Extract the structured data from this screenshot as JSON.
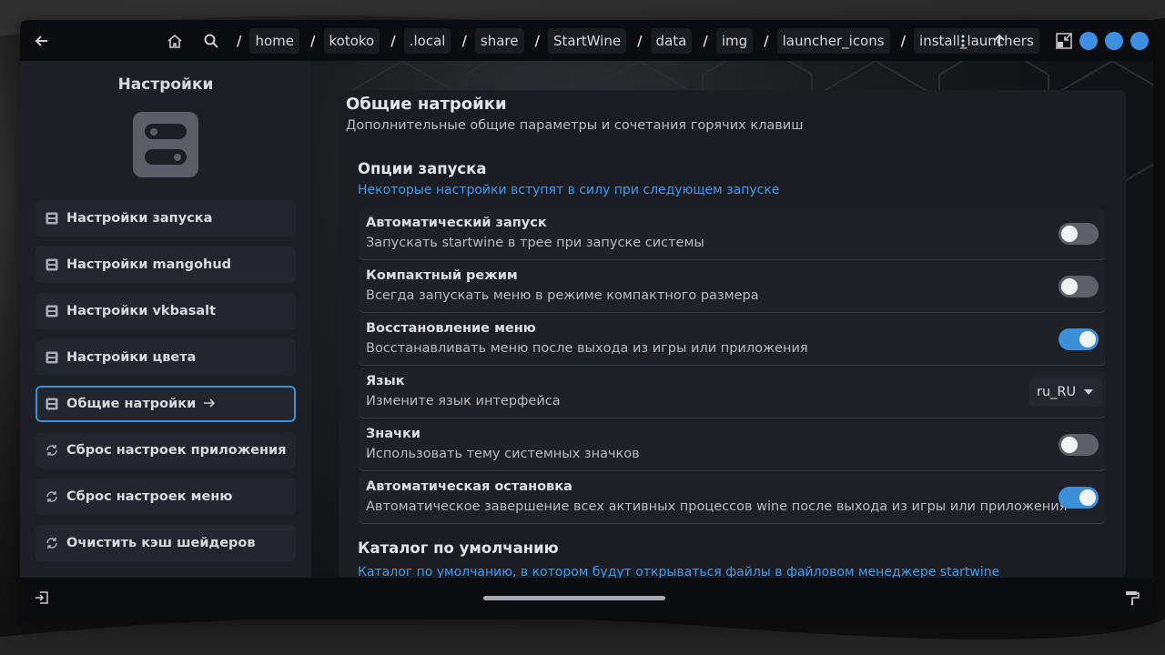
{
  "topbar": {
    "breadcrumbs": [
      "home",
      "kotoko",
      ".local",
      "share",
      "StartWine",
      "data",
      "img",
      "launcher_icons",
      "install_launchers"
    ],
    "separator": "/"
  },
  "sidebar": {
    "title": "Настройки",
    "items": [
      {
        "label": "Настройки запуска",
        "icon": "list-settings-icon"
      },
      {
        "label": "Настройки mangohud",
        "icon": "list-settings-icon"
      },
      {
        "label": "Настройки vkbasalt",
        "icon": "list-settings-icon"
      },
      {
        "label": "Настройки цвета",
        "icon": "list-settings-icon"
      },
      {
        "label": "Общие натройки",
        "icon": "list-settings-icon",
        "active": true
      },
      {
        "label": "Сброс настроек приложения",
        "icon": "refresh-icon"
      },
      {
        "label": "Сброс настроек меню",
        "icon": "refresh-icon"
      },
      {
        "label": "Очистить кэш шейдеров",
        "icon": "refresh-icon"
      }
    ]
  },
  "main": {
    "title": "Общие натройки",
    "subtitle": "Дополнительные общие параметры и сочетания горячих клавиш",
    "launch_group": {
      "title": "Опции запуска",
      "subtitle": "Некоторые настройки вступят в силу при следующем запуске"
    },
    "rows": [
      {
        "title": "Автоматический запуск",
        "subtitle": "Запускать startwine в трее при запуске системы",
        "control": "toggle",
        "value": false
      },
      {
        "title": "Компактный режим",
        "subtitle": "Всегда запускать меню в режиме компактного размера",
        "control": "toggle",
        "value": false
      },
      {
        "title": "Восстановление меню",
        "subtitle": "Восстанавливать меню после выхода из игры или приложения",
        "control": "toggle",
        "value": true
      },
      {
        "title": "Язык",
        "subtitle": "Измените язык интерфейса",
        "control": "dropdown",
        "value": "ru_RU"
      },
      {
        "title": "Значки",
        "subtitle": "Использовать тему системных значков",
        "control": "toggle",
        "value": false
      },
      {
        "title": "Автоматическая остановка",
        "subtitle": "Автоматическое завершение всех активных процессов wine после выхода из игры или приложения",
        "control": "toggle",
        "value": true
      }
    ],
    "catalog_group": {
      "title": "Каталог по умолчанию",
      "subtitle": "Каталог по умолчанию, в котором будут открываться файлы в файловом менеджере startwine"
    }
  },
  "colors": {
    "accent": "#3d8fd8",
    "link": "#3d9bf0",
    "window_dots": "#3f8fe0"
  }
}
